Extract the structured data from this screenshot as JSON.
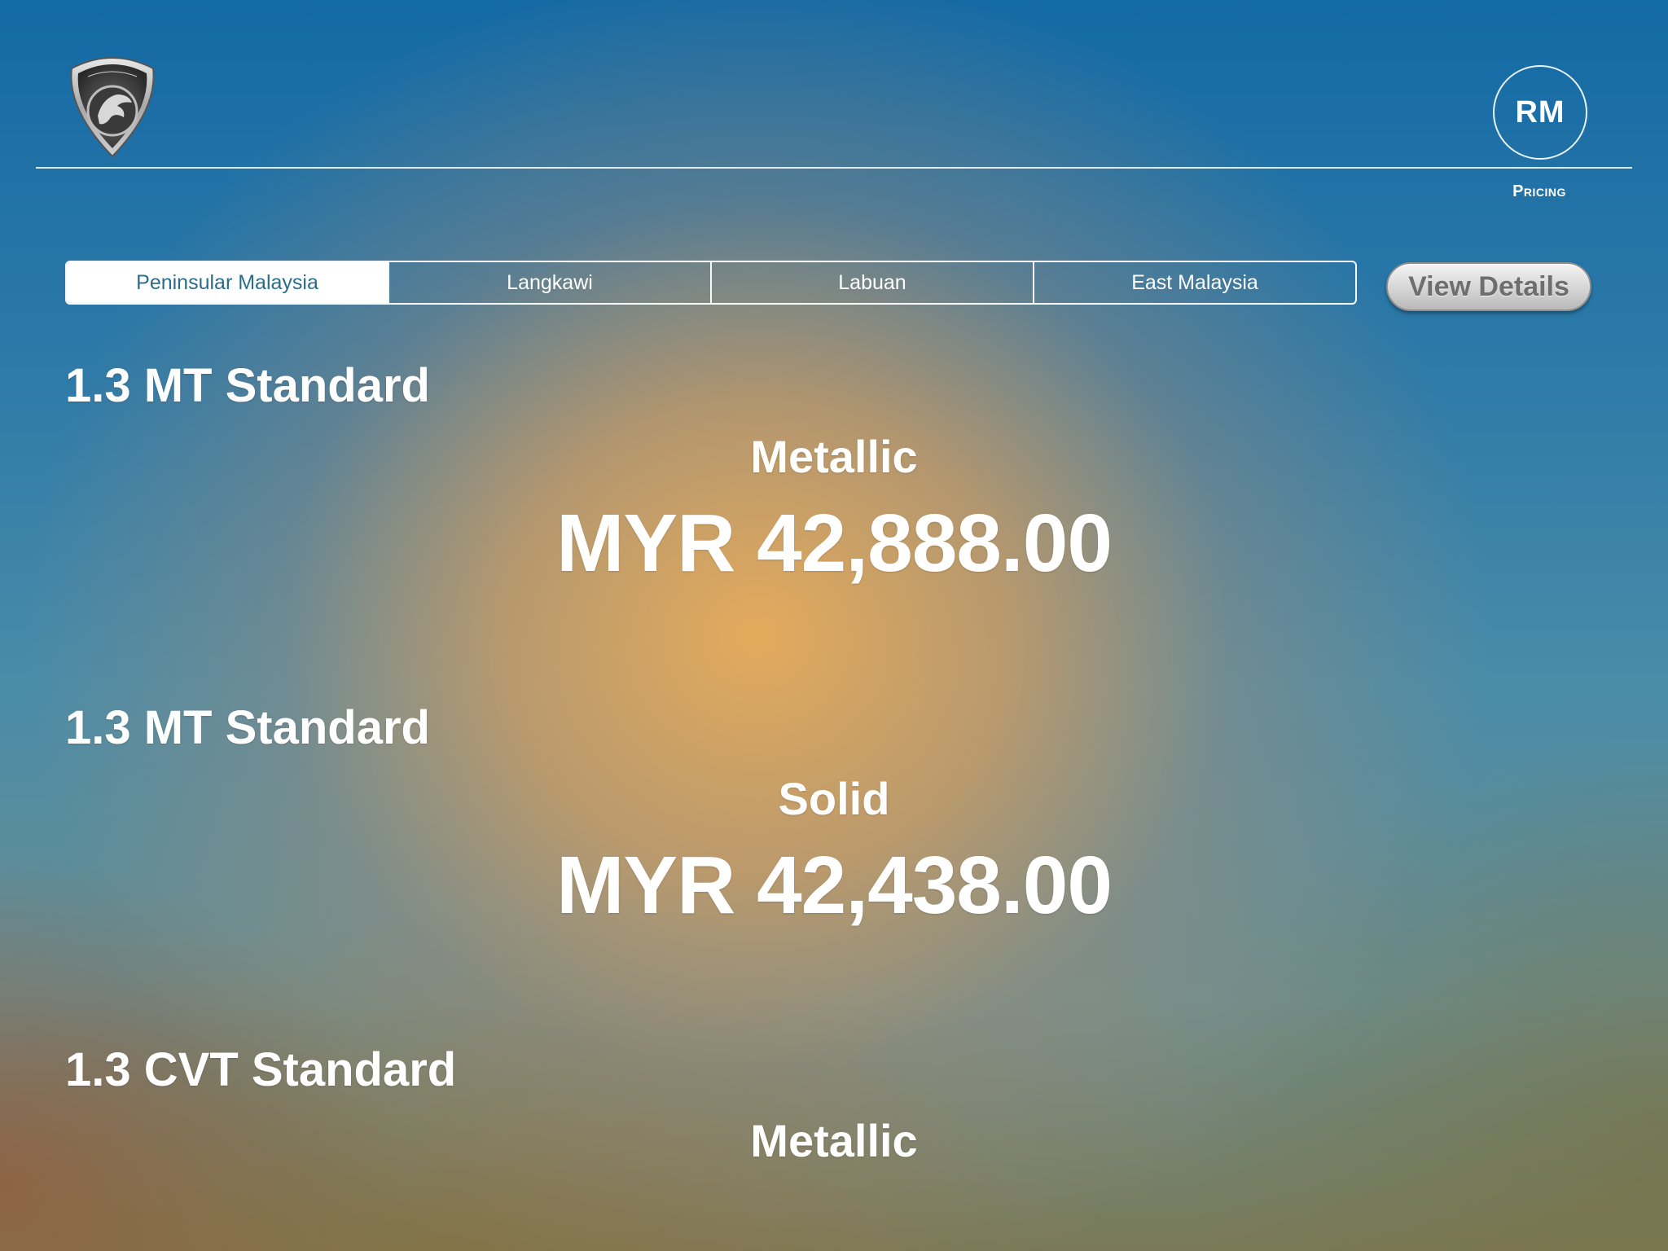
{
  "header": {
    "logo_text": "PROTON",
    "currency_button_label": "RM",
    "section_label": "Pricing"
  },
  "region_tabs": [
    {
      "label": "Peninsular Malaysia",
      "active": true
    },
    {
      "label": "Langkawi",
      "active": false
    },
    {
      "label": "Labuan",
      "active": false
    },
    {
      "label": "East Malaysia",
      "active": false
    }
  ],
  "view_details_label": "View Details",
  "prices": [
    {
      "model": "1.3 MT Standard",
      "paint": "Metallic",
      "price": "MYR 42,888.00"
    },
    {
      "model": "1.3 MT Standard",
      "paint": "Solid",
      "price": "MYR 42,438.00"
    },
    {
      "model": "1.3 CVT Standard",
      "paint": "Metallic",
      "price": ""
    }
  ],
  "colors": {
    "active_tab_text": "#2b6d8c",
    "text": "#ffffff"
  }
}
